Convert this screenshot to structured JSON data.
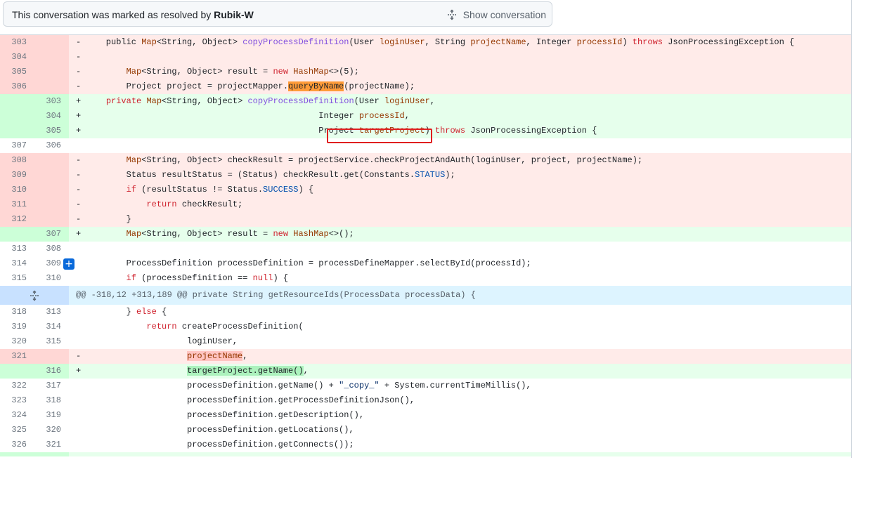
{
  "banner": {
    "resolved_prefix": "This conversation was marked as resolved by",
    "resolved_by": "Rubik-W",
    "show_label": "Show conversation"
  },
  "hunk": {
    "header": "@@ -318,12 +313,189 @@ private String getResourceIds(ProcessData processData) {"
  },
  "lines": [
    {
      "old": "303",
      "new": "",
      "mark": "-"
    },
    {
      "old": "304",
      "new": "",
      "mark": "-"
    },
    {
      "old": "305",
      "new": "",
      "mark": "-"
    },
    {
      "old": "306",
      "new": "",
      "mark": "-"
    },
    {
      "old": "",
      "new": "303",
      "mark": "+"
    },
    {
      "old": "",
      "new": "304",
      "mark": "+"
    },
    {
      "old": "",
      "new": "305",
      "mark": "+"
    },
    {
      "old": "307",
      "new": "306",
      "mark": ""
    },
    {
      "old": "308",
      "new": "",
      "mark": "-"
    },
    {
      "old": "309",
      "new": "",
      "mark": "-"
    },
    {
      "old": "310",
      "new": "",
      "mark": "-"
    },
    {
      "old": "311",
      "new": "",
      "mark": "-"
    },
    {
      "old": "312",
      "new": "",
      "mark": "-"
    },
    {
      "old": "",
      "new": "307",
      "mark": "+"
    },
    {
      "old": "313",
      "new": "308",
      "mark": ""
    },
    {
      "old": "314",
      "new": "309",
      "mark": ""
    },
    {
      "old": "315",
      "new": "310",
      "mark": ""
    },
    {
      "old": "318",
      "new": "313",
      "mark": ""
    },
    {
      "old": "319",
      "new": "314",
      "mark": ""
    },
    {
      "old": "320",
      "new": "315",
      "mark": ""
    },
    {
      "old": "321",
      "new": "",
      "mark": "-"
    },
    {
      "old": "",
      "new": "316",
      "mark": "+"
    },
    {
      "old": "322",
      "new": "317",
      "mark": ""
    },
    {
      "old": "323",
      "new": "318",
      "mark": ""
    },
    {
      "old": "324",
      "new": "319",
      "mark": ""
    },
    {
      "old": "325",
      "new": "320",
      "mark": ""
    },
    {
      "old": "326",
      "new": "321",
      "mark": ""
    }
  ],
  "code": {
    "l303_a": "    public ",
    "l303_b": "Map",
    "l303_c": "<String, Object> ",
    "l303_d": "copyProcessDefinition",
    "l303_e": "(User ",
    "l303_f": "loginUser",
    "l303_g": ", String ",
    "l303_h": "projectName",
    "l303_i": ", Integer ",
    "l303_j": "processId",
    "l303_k": ") ",
    "l303_l": "throws",
    "l303_m": " JsonProcessingException {",
    "l305_a": "        ",
    "l305_b": "Map",
    "l305_c": "<String, Object> result = ",
    "l305_d": "new",
    "l305_e": " ",
    "l305_f": "HashMap",
    "l305_g": "<>(5);",
    "l306_a": "        Project project = projectMapper.",
    "l306_b": "queryByName",
    "l306_c": "(projectName);",
    "n303_a": "    ",
    "n303_b": "private",
    "n303_c": " ",
    "n303_d": "Map",
    "n303_e": "<String, Object> ",
    "n303_f": "copyProcessDefinition",
    "n303_g": "(User ",
    "n303_h": "loginUser",
    "n303_i": ",",
    "n304_a": "                                              Integer ",
    "n304_b": "processId",
    "n304_c": ",",
    "n305_a": "                                              Project ",
    "n305_b": "targetProject",
    "n305_c": ") ",
    "n305_d": "throws",
    "n305_e": " JsonProcessingException {",
    "l308_a": "        ",
    "l308_b": "Map",
    "l308_c": "<String, Object> checkResult = projectService.checkProjectAndAuth(loginUser, project, projectName);",
    "l309_a": "        Status resultStatus = (Status) checkResult.get(Constants.",
    "l309_b": "STATUS",
    "l309_c": ");",
    "l310_a": "        ",
    "l310_b": "if",
    "l310_c": " (resultStatus != Status.",
    "l310_d": "SUCCESS",
    "l310_e": ") {",
    "l311_a": "            ",
    "l311_b": "return",
    "l311_c": " checkResult;",
    "l312_a": "        }",
    "n307_a": "        ",
    "n307_b": "Map",
    "n307_c": "<String, Object> result = ",
    "n307_d": "new",
    "n307_e": " ",
    "n307_f": "HashMap",
    "n307_g": "<>();",
    "c314_a": "        ProcessDefinition processDefinition = processDefineMapper.selectById(processId);",
    "c315_a": "        ",
    "c315_b": "if",
    "c315_c": " (processDefinition == ",
    "c315_d": "null",
    "c315_e": ") {",
    "c318_a": "        } ",
    "c318_b": "else",
    "c318_c": " {",
    "c319_a": "            ",
    "c319_b": "return",
    "c319_c": " createProcessDefinition(",
    "c320_a": "                    loginUser,",
    "d321_a": "                    ",
    "d321_b": "projectName",
    "d321_c": ",",
    "a316_a": "                    ",
    "a316_b": "targetProject.getName()",
    "a316_c": ",",
    "c322_a": "                    processDefinition.getName() + ",
    "c322_b": "\"_copy_\"",
    "c322_c": " + System.currentTimeMillis(),",
    "c323_a": "                    processDefinition.getProcessDefinitionJson(),",
    "c324_a": "                    processDefinition.getDescription(),",
    "c325_a": "                    processDefinition.getLocations(),",
    "c326_a": "                    processDefinition.getConnects());"
  }
}
